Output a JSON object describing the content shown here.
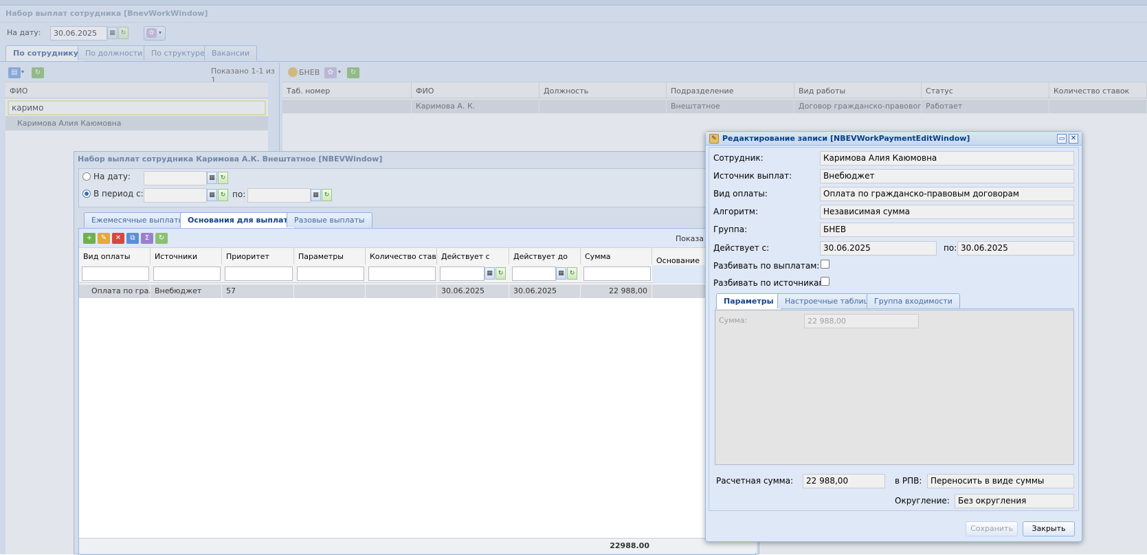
{
  "main_window": {
    "title": "Набор выплат сотрудника [BnevWorkWindow]",
    "date_label": "На дату:",
    "date_value": "30.06.2025",
    "tabs": [
      "По сотруднику",
      "По должности",
      "По структуре",
      "Вакансии"
    ],
    "left_panel": {
      "shown": "Показано 1-1 из 1",
      "column": "ФИО",
      "filter_value": "каримо",
      "rows": [
        "Каримова Алия Каюмовна"
      ]
    },
    "right_panel": {
      "toolbar_label": "БНЕВ",
      "columns": [
        "Таб. номер",
        "ФИО",
        "Должность",
        "Подразделение",
        "Вид работы",
        "Статус",
        "Количество ставок"
      ],
      "rows": [
        [
          "",
          "Каримова А. К.",
          "",
          "Внештатное",
          "Договор гражданско-правового ...",
          "Работает",
          ""
        ]
      ]
    }
  },
  "nbev_window": {
    "title": "Набор выплат сотрудника Каримова А.К. Внештатное [NBEVWindow]",
    "radio_date_label": "На дату:",
    "radio_period_label": "В период с:",
    "period_to_label": "по:",
    "tabs": [
      "Ежемесячные выплаты",
      "Основания для выплат",
      "Разовые выплаты"
    ],
    "shown": "Показа",
    "columns": [
      "Вид оплаты",
      "Источники",
      "Приоритет",
      "Параметры",
      "Количество став...",
      "Действует с",
      "Действует до",
      "Сумма",
      "Основание"
    ],
    "rows": [
      [
        "Оплата по гра...",
        "Внебюджет",
        "57",
        "",
        "",
        "30.06.2025",
        "30.06.2025",
        "22 988,00",
        ""
      ]
    ],
    "total": "22988.00"
  },
  "edit_window": {
    "title": "Редактирование записи [NBEVWorkPaymentEditWindow]",
    "fields": [
      {
        "label": "Сотрудник:",
        "value": "Каримова Алия Каюмовна"
      },
      {
        "label": "Источник выплат:",
        "value": "Внебюджет"
      },
      {
        "label": "Вид оплаты:",
        "value": "Оплата по гражданско-правовым договорам"
      },
      {
        "label": "Алгоритм:",
        "value": "Независимая сумма"
      },
      {
        "label": "Группа:",
        "value": "БНЕВ"
      }
    ],
    "active_from_label": "Действует с:",
    "active_from": "30.06.2025",
    "active_to_label": "по:",
    "active_to": "30.06.2025",
    "split_payments_label": "Разбивать по выплатам:",
    "split_sources_label": "Разбивать по источникам:",
    "tabs": [
      "Параметры",
      "Настроечные таблицы",
      "Группа входимости"
    ],
    "param_sum_label": "Сумма:",
    "param_sum_value": "22 988,00",
    "calc_sum_label": "Расчетная сумма:",
    "calc_sum_value": "22 988,00",
    "rpv_label": "в РПВ:",
    "rpv_value": "Переносить в виде суммы",
    "rounding_label": "Округление:",
    "rounding_value": "Без округления",
    "save_label": "Сохранить",
    "close_label": "Закрыть"
  },
  "colors": {
    "accent": "#15428b",
    "border": "#99bbe8",
    "header_bg": "#dfe8f6"
  }
}
